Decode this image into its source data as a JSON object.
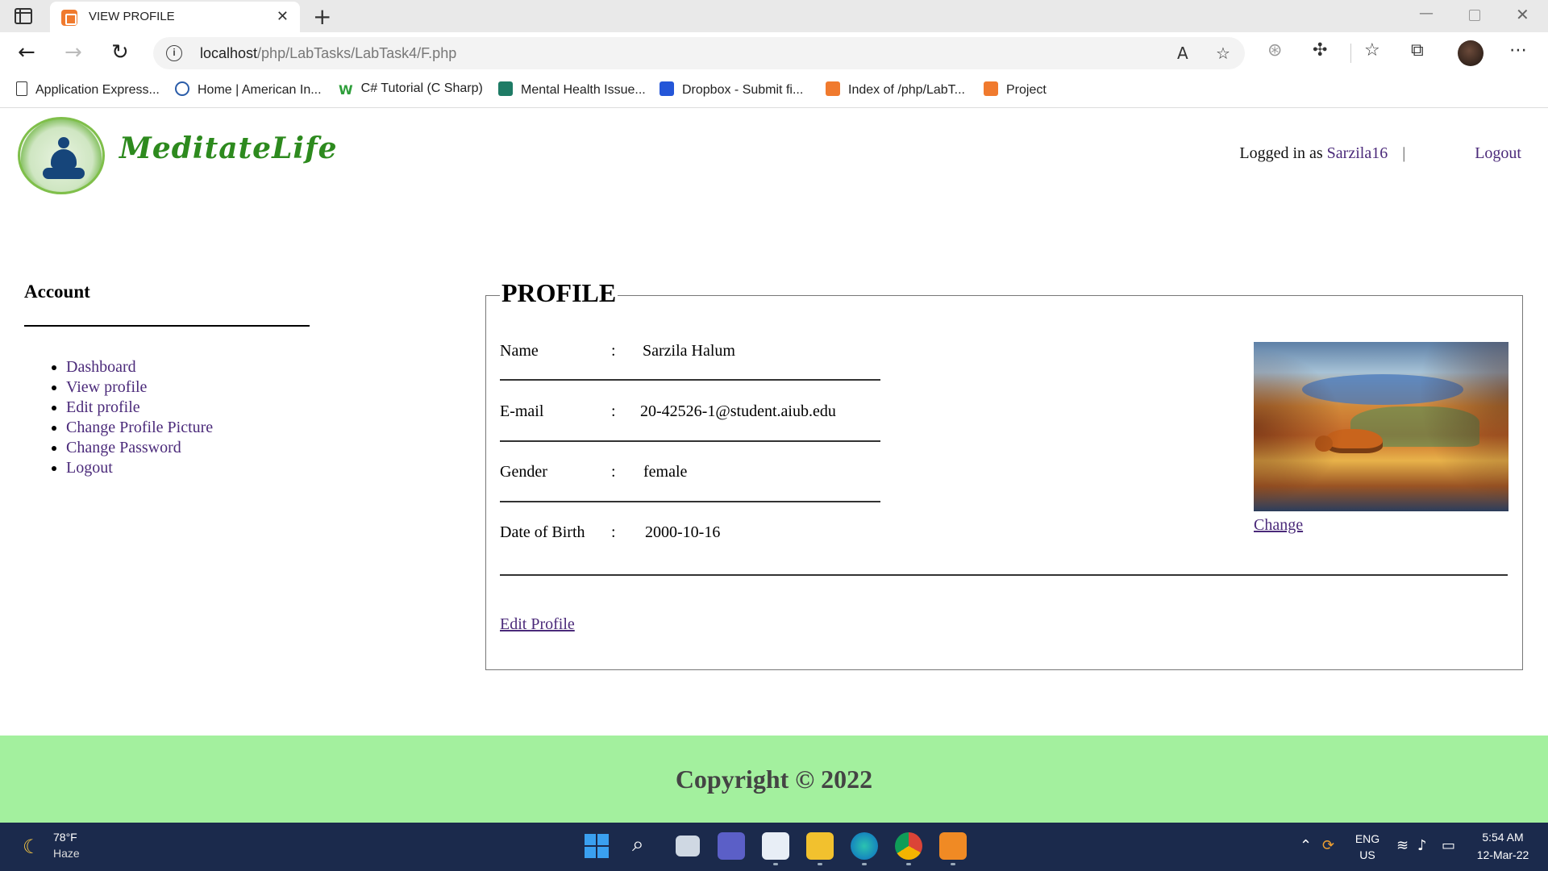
{
  "browser": {
    "tab_title": "VIEW PROFILE",
    "url_host": "localhost",
    "url_path": "/php/LabTasks/LabTask4/F.php",
    "bookmarks": [
      {
        "label": "Application Express...",
        "icon": "page-icon"
      },
      {
        "label": "Home | American In...",
        "icon": "globe-icon"
      },
      {
        "label": "C# Tutorial (C Sharp)",
        "icon": "w3schools-icon"
      },
      {
        "label": "Mental Health Issue...",
        "icon": "sheet-icon"
      },
      {
        "label": "Dropbox - Submit fi...",
        "icon": "dropbox-icon"
      },
      {
        "label": "Index of /php/LabT...",
        "icon": "xampp-icon"
      },
      {
        "label": "Project",
        "icon": "xampp-icon"
      }
    ]
  },
  "header": {
    "logo_text": "MeditateLife",
    "logged_in_prefix": "Logged in as ",
    "username": "Sarzila16",
    "separator": "|",
    "logout": "Logout"
  },
  "sidebar": {
    "heading": "Account",
    "items": [
      "Dashboard",
      "View profile",
      "Edit profile",
      "Change Profile Picture",
      "Change Password",
      "Logout"
    ]
  },
  "profile": {
    "legend": "PROFILE",
    "colon": ":",
    "fields": [
      {
        "label": "Name",
        "value": "Sarzila Halum"
      },
      {
        "label": "E-mail",
        "value": "20-42526-1@student.aiub.edu"
      },
      {
        "label": "Gender",
        "value": "female"
      },
      {
        "label": "Date of Birth",
        "value": "2000-10-16"
      }
    ],
    "change_link": "Change",
    "edit_link": "Edit Profile"
  },
  "footer": {
    "copyright": "Copyright © 2022"
  },
  "taskbar": {
    "temperature": "78°F",
    "condition": "Haze",
    "language": "ENG",
    "region": "US",
    "time": "5:54 AM",
    "date": "12-Mar-22"
  },
  "colors": {
    "link": "#4b2a7a",
    "logo_green": "#2d8a1e",
    "footer_bg": "#a3f09e",
    "taskbar_bg": "#1b2a4c"
  }
}
